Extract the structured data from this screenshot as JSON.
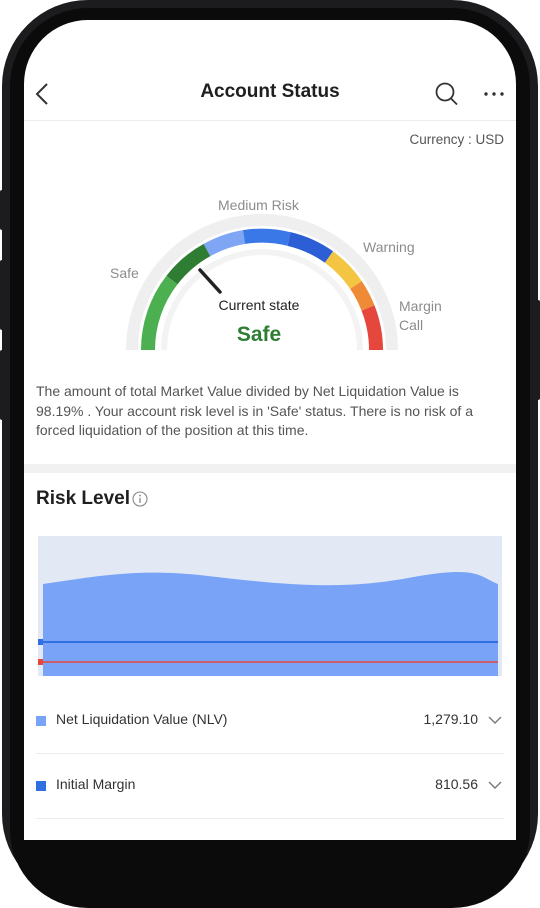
{
  "header": {
    "title": "Account Status",
    "back_icon": "back-icon",
    "search_icon": "search-icon",
    "more_icon": "more-icon"
  },
  "currency_label": "Currency : USD",
  "gauge": {
    "labels": {
      "safe": "Safe",
      "medium": "Medium Risk",
      "warning": "Warning",
      "margin": "Margin",
      "call": "Call"
    },
    "current_state_caption": "Current state",
    "current_state": "Safe",
    "colors": [
      "#4caf50",
      "#2e7d32",
      "#7ea6f5",
      "#2f6fe0",
      "#f4c542",
      "#ef8a36",
      "#e5473d"
    ]
  },
  "description": "The amount of total Market Value divided by Net Liquidation Value is 98.19% . Your account risk level is in 'Safe' status. There is no risk of a forced liquidation of the position at this time.",
  "risk_level": {
    "title": "Risk Level",
    "info_icon": "info-icon"
  },
  "chart_data": {
    "type": "area",
    "series": [
      {
        "name": "Net Liquidation Value (NLV)",
        "color": "#79a3f6"
      },
      {
        "name": "Initial Margin",
        "color": "#2f6fe0"
      }
    ]
  },
  "legend": [
    {
      "label": "Net Liquidation Value (NLV)",
      "value": "1,279.10",
      "color": "#79a3f6"
    },
    {
      "label": "Initial Margin",
      "value": "810.56",
      "color": "#2f6fe0"
    }
  ]
}
